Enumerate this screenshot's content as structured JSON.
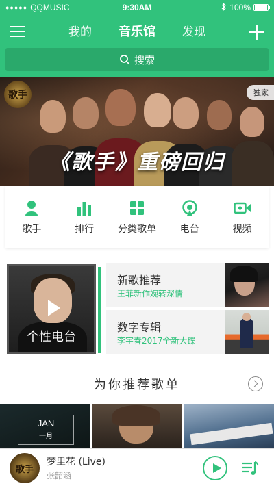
{
  "status_bar": {
    "carrier": "QQMUSIC",
    "time": "9:30AM",
    "battery": "100%",
    "battery_level": 1.0
  },
  "header": {
    "menu_icon": "hamburger-menu-icon",
    "tabs": [
      {
        "label": "我的",
        "active": false
      },
      {
        "label": "音乐馆",
        "active": true
      },
      {
        "label": "发现",
        "active": false
      }
    ],
    "add_icon": "plus-icon"
  },
  "search": {
    "placeholder": "搜索",
    "icon": "search-icon"
  },
  "banner": {
    "badge": "独家",
    "title": "《歌手》重磅回归",
    "logo_text": "歌手"
  },
  "quick_nav": [
    {
      "label": "歌手",
      "icon": "singer-icon"
    },
    {
      "label": "排行",
      "icon": "chart-icon"
    },
    {
      "label": "分类歌单",
      "icon": "category-grid-icon"
    },
    {
      "label": "电台",
      "icon": "radio-icon"
    },
    {
      "label": "视频",
      "icon": "video-icon"
    }
  ],
  "personal_radio": {
    "title": "个性电台",
    "icon": "play-icon"
  },
  "recommendations": [
    {
      "title": "新歌推荐",
      "subtitle": "王菲新作婉转深情"
    },
    {
      "title": "数字专辑",
      "subtitle": "李宇春2017全新大碟"
    }
  ],
  "playlist_section": {
    "title": "为你推荐歌单",
    "cards": [
      {
        "month": "JAN",
        "month_cn": "一月"
      },
      {},
      {}
    ]
  },
  "player": {
    "song": "梦里花 (Live)",
    "artist": "张韶涵",
    "cover_text": "歌手"
  },
  "colors": {
    "accent": "#31c27c"
  }
}
